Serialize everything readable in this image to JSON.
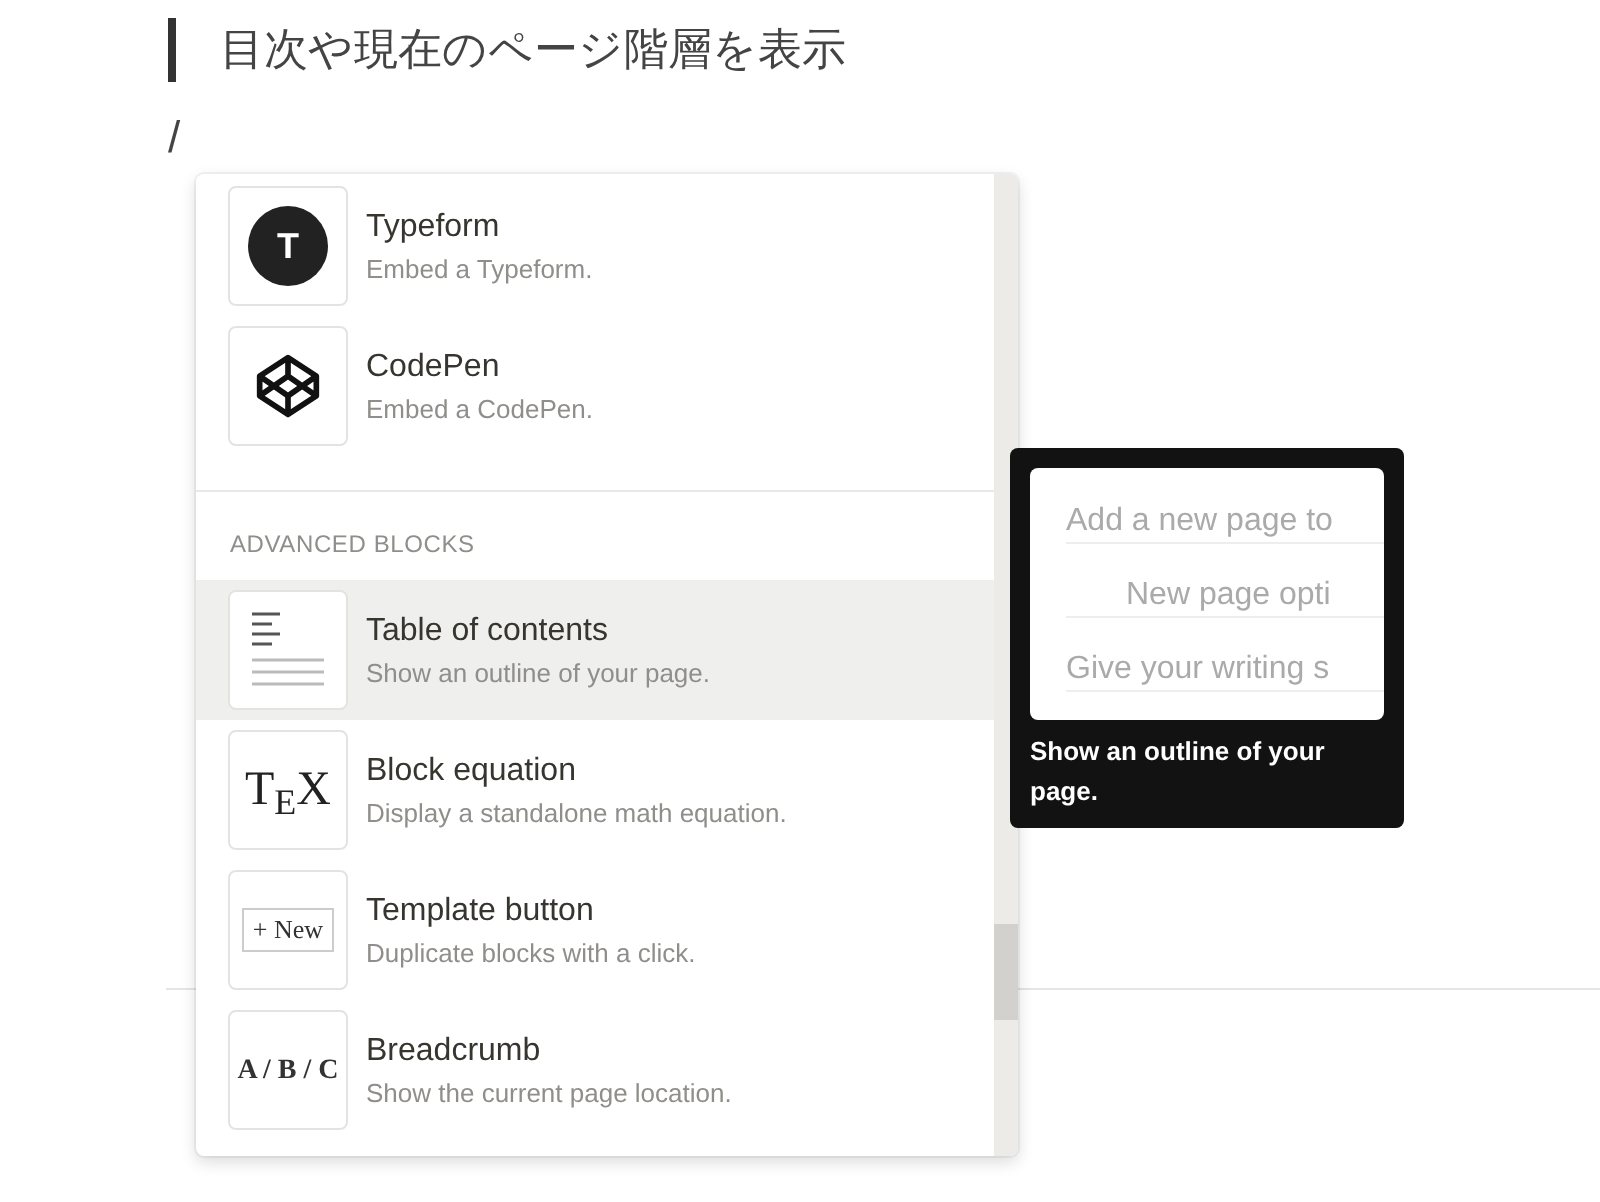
{
  "page": {
    "quote": "目次や現在のページ階層を表示",
    "typed": "/"
  },
  "menu": {
    "items_top": [
      {
        "kind": "typeform",
        "icon_text": "T",
        "title": "Typeform",
        "description": "Embed a Typeform.",
        "selected": false
      },
      {
        "kind": "codepen",
        "title": "CodePen",
        "description": "Embed a CodePen.",
        "selected": false
      }
    ],
    "section": "ADVANCED BLOCKS",
    "items": [
      {
        "kind": "toc",
        "title": "Table of contents",
        "description": "Show an outline of your page.",
        "selected": true
      },
      {
        "kind": "tex",
        "icon_text": "T$_{E}$X",
        "title": "Block equation",
        "description": "Display a standalone math equation.",
        "selected": false
      },
      {
        "kind": "template",
        "icon_text": "+ New",
        "title": "Template button",
        "description": "Duplicate blocks with a click.",
        "selected": false
      },
      {
        "kind": "breadcrumb",
        "icon_text": "A / B / C",
        "title": "Breadcrumb",
        "description": "Show the current page location.",
        "selected": false
      }
    ]
  },
  "tooltip": {
    "preview": [
      {
        "text": "Add a new page to",
        "children": [
          {
            "text": "New page opti"
          }
        ]
      },
      {
        "text": "Give your writing s"
      }
    ],
    "caption": "Show an outline of your page."
  }
}
